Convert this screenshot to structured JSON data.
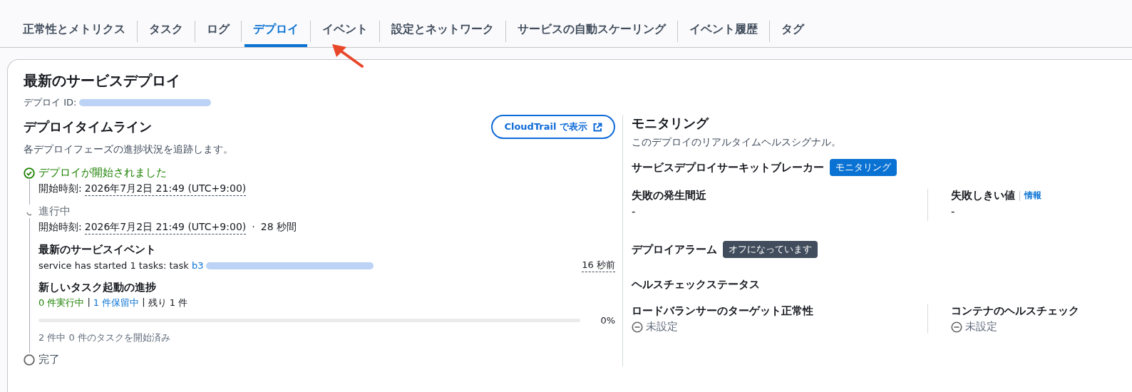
{
  "tabs": [
    {
      "label": "正常性とメトリクス",
      "selected": false
    },
    {
      "label": "タスク",
      "selected": false
    },
    {
      "label": "ログ",
      "selected": false
    },
    {
      "label": "デプロイ",
      "selected": true
    },
    {
      "label": "イベント",
      "selected": false
    },
    {
      "label": "設定とネットワーク",
      "selected": false
    },
    {
      "label": "サービスの自動スケーリング",
      "selected": false
    },
    {
      "label": "イベント履歴",
      "selected": false
    },
    {
      "label": "タグ",
      "selected": false
    }
  ],
  "deployment": {
    "title": "最新のサービスデプロイ",
    "id_label": "デプロイ ID:"
  },
  "timeline": {
    "title": "デプロイタイムライン",
    "description": "各デプロイフェーズの進捗状況を追跡します。",
    "button": "CloudTrail で表示",
    "steps": [
      {
        "kind": "completed",
        "label": "デプロイが開始されました",
        "start_label": "開始時刻:",
        "start_time": "2026年7月2日 21:49 (UTC+9:00)"
      },
      {
        "kind": "in_progress",
        "label": "進行中",
        "start_label": "開始時刻:",
        "start_time": "2026年7月2日 21:49 (UTC+9:00)",
        "dot": "·",
        "duration": "28 秒間",
        "event_title": "最新のサービスイベント",
        "event_text": "service has started 1 tasks: task",
        "event_link": "b3",
        "event_age": "16 秒前",
        "progress_title": "新しいタスク起動の進捗",
        "running": "0 件実行中",
        "separator_1": "|",
        "pending": "1 件保留中",
        "separator_2": "|",
        "remaining": "残り 1 件",
        "level": 0,
        "percent": "0%",
        "caption": "2 件中 0 件のタスクを開始済み"
      },
      {
        "kind": "pending",
        "label": "完了"
      }
    ]
  },
  "monitoring": {
    "title": "モニタリング",
    "description": "このデプロイのリアルタイムヘルスシグナル。",
    "circuit_breaker": {
      "title": "サービスデプロイサーキットブレーカー",
      "badge": "モニタリング",
      "badge_on": true,
      "fields": [
        {
          "label": "失敗の発生間近",
          "value": "-"
        },
        {
          "label": "失敗しきい値",
          "info": "情報",
          "value": "-"
        }
      ]
    },
    "alarms": {
      "title": "デプロイアラーム",
      "badge": "オフになっています",
      "badge_on": false
    },
    "health": {
      "title": "ヘルスチェックステータス",
      "fields": [
        {
          "label": "ロードバランサーのターゲット正常性",
          "value": "未設定"
        },
        {
          "label": "コンテナのヘルスチェック",
          "value": "未設定"
        }
      ]
    }
  }
}
